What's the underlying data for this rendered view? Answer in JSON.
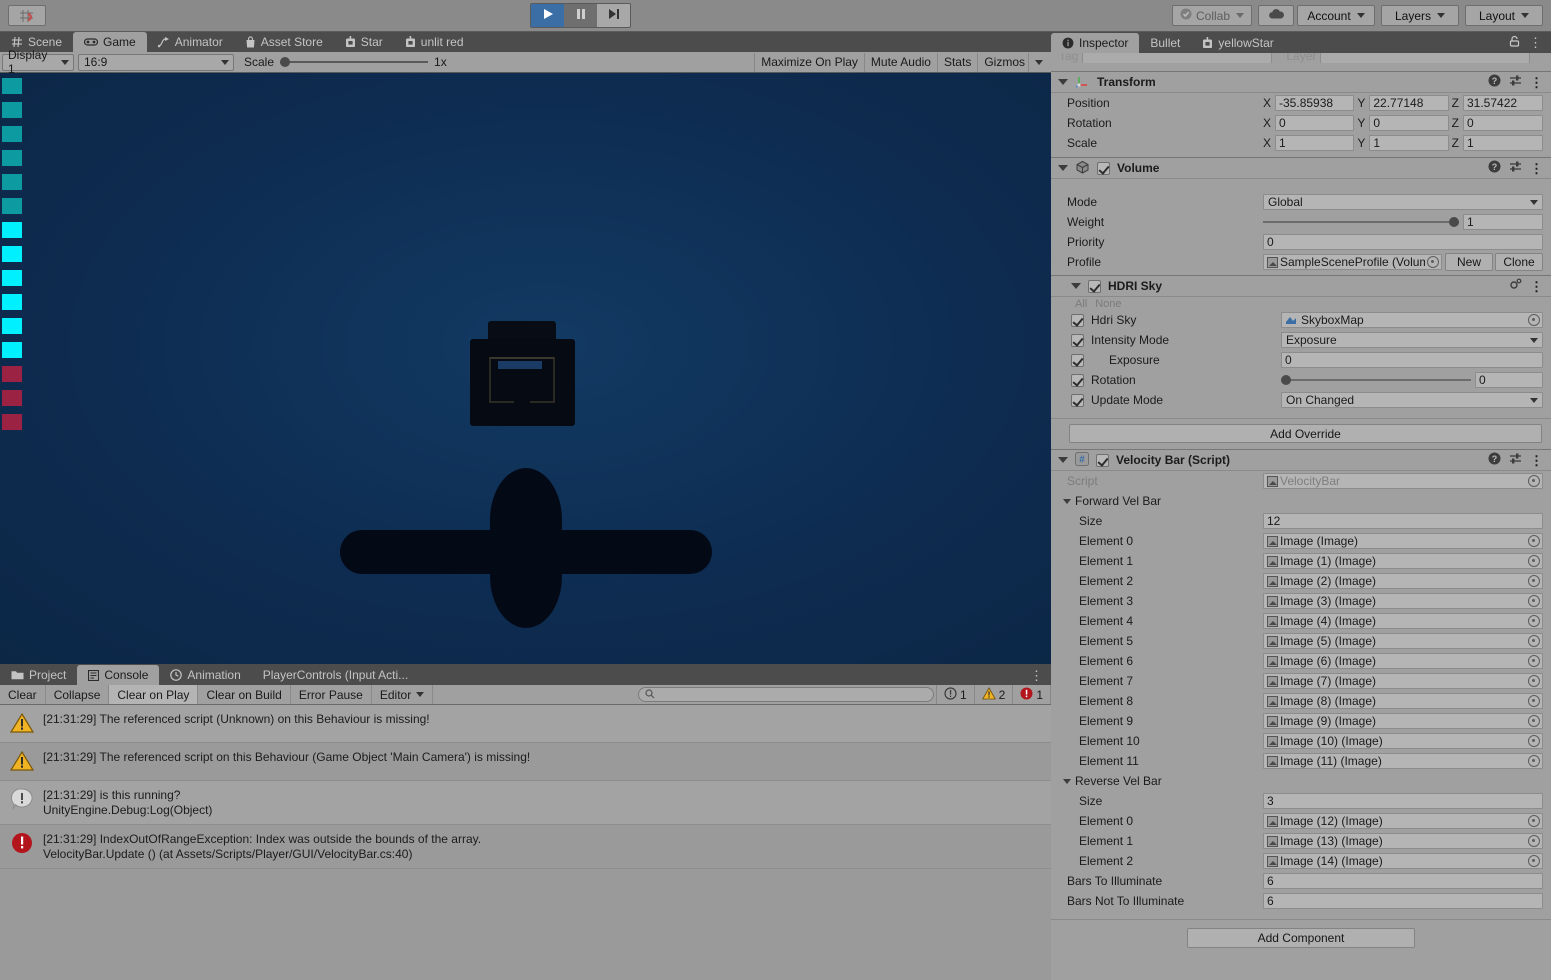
{
  "toolbar": {
    "snap_icon": "grid-snap-icon",
    "play_label": "play-icon",
    "pause_label": "pause-icon",
    "step_label": "step-icon",
    "collab": "Collab",
    "cloud": "cloud-icon",
    "account": "Account",
    "layers": "Layers",
    "layout": "Layout"
  },
  "game_panel": {
    "tabs": [
      {
        "label": "Scene",
        "icon": "hash-icon",
        "active": false
      },
      {
        "label": "Game",
        "icon": "gamepad-icon",
        "active": true
      },
      {
        "label": "Animator",
        "icon": "animator-icon",
        "active": false
      },
      {
        "label": "Asset Store",
        "icon": "store-icon",
        "active": false
      },
      {
        "label": "Star",
        "icon": "prefab-icon",
        "active": false
      },
      {
        "label": "unlit red",
        "icon": "prefab-icon",
        "active": false
      }
    ],
    "display": "Display 1",
    "aspect": "16:9",
    "scale_label": "Scale",
    "scale_value": "1x",
    "maximize_on_play": "Maximize On Play",
    "mute_audio": "Mute Audio",
    "stats": "Stats",
    "gizmos": "Gizmos"
  },
  "game_render": {
    "background_color": "#0e2c51",
    "bars": [
      {
        "color": "#0d9aa0",
        "state": "dim"
      },
      {
        "color": "#0d9aa0",
        "state": "dim"
      },
      {
        "color": "#0d9aa0",
        "state": "dim"
      },
      {
        "color": "#0d9aa0",
        "state": "dim"
      },
      {
        "color": "#0d9aa0",
        "state": "dim"
      },
      {
        "color": "#0d9aa0",
        "state": "dim"
      },
      {
        "color": "#00f0ff",
        "state": "lit"
      },
      {
        "color": "#00f0ff",
        "state": "lit"
      },
      {
        "color": "#00f0ff",
        "state": "lit"
      },
      {
        "color": "#00f0ff",
        "state": "lit"
      },
      {
        "color": "#00f0ff",
        "state": "lit"
      },
      {
        "color": "#00f0ff",
        "state": "lit"
      },
      {
        "color": "#9c2244",
        "state": "reverse"
      },
      {
        "color": "#9c2244",
        "state": "reverse"
      },
      {
        "color": "#9c2244",
        "state": "reverse"
      }
    ]
  },
  "console_panel": {
    "tabs": [
      {
        "label": "Project",
        "icon": "folder-icon",
        "active": false
      },
      {
        "label": "Console",
        "icon": "console-icon",
        "active": true
      },
      {
        "label": "Animation",
        "icon": "clock-icon",
        "active": false
      },
      {
        "label": "PlayerControls (Input Acti...",
        "icon": "",
        "active": false
      }
    ],
    "buttons": [
      {
        "label": "Clear",
        "pressed": false
      },
      {
        "label": "Collapse",
        "pressed": false
      },
      {
        "label": "Clear on Play",
        "pressed": true
      },
      {
        "label": "Clear on Build",
        "pressed": false
      },
      {
        "label": "Error Pause",
        "pressed": false
      },
      {
        "label": "Editor",
        "pressed": false,
        "dropdown": true
      }
    ],
    "search_placeholder": "",
    "counts": {
      "info": "1",
      "warning": "2",
      "error": "1"
    },
    "logs": [
      {
        "type": "warning",
        "line1": "[21:31:29] The referenced script (Unknown) on this Behaviour is missing!",
        "line2": ""
      },
      {
        "type": "warning",
        "line1": "[21:31:29] The referenced script on this Behaviour (Game Object 'Main Camera') is missing!",
        "line2": ""
      },
      {
        "type": "info",
        "line1": "[21:31:29] is this running?",
        "line2": "UnityEngine.Debug:Log(Object)"
      },
      {
        "type": "error",
        "line1": "[21:31:29] IndexOutOfRangeException: Index was outside the bounds of the array.",
        "line2": "VelocityBar.Update () (at Assets/Scripts/Player/GUI/VelocityBar.cs:40)"
      }
    ]
  },
  "inspector": {
    "tabs": [
      {
        "label": "Inspector",
        "icon": "info-icon",
        "active": true
      },
      {
        "label": "Bullet",
        "icon": "",
        "active": false
      },
      {
        "label": "yellowStar",
        "icon": "prefab-icon",
        "active": false
      }
    ],
    "lock_icon": "lock-icon",
    "kebab_icon": "kebab-icon",
    "tag_label": "Tag",
    "layer_label": "Layer",
    "transform": {
      "title": "Transform",
      "rows": [
        {
          "label": "Position",
          "x": "-35.85938",
          "y": "22.77148",
          "z": "31.57422"
        },
        {
          "label": "Rotation",
          "x": "0",
          "y": "0",
          "z": "0"
        },
        {
          "label": "Scale",
          "x": "1",
          "y": "1",
          "z": "1"
        }
      ],
      "axis_labels": [
        "X",
        "Y",
        "Z"
      ]
    },
    "volume": {
      "title": "Volume",
      "mode_label": "Mode",
      "mode_value": "Global",
      "weight_label": "Weight",
      "weight_value": "1",
      "priority_label": "Priority",
      "priority_value": "0",
      "profile_label": "Profile",
      "profile_value": "SampleSceneProfile (Volume",
      "new_button": "New",
      "clone_button": "Clone"
    },
    "hdri_sky": {
      "title": "HDRI Sky",
      "all_label": "All",
      "none_label": "None",
      "rows": [
        {
          "label": "Hdri Sky",
          "value": "SkyboxMap",
          "kind": "object"
        },
        {
          "label": "Intensity Mode",
          "value": "Exposure",
          "kind": "dropdown"
        },
        {
          "label": "Exposure",
          "value": "0",
          "kind": "text",
          "indent": true
        },
        {
          "label": "Rotation",
          "value": "0",
          "kind": "slider"
        },
        {
          "label": "Update Mode",
          "value": "On Changed",
          "kind": "dropdown"
        }
      ],
      "add_override": "Add Override"
    },
    "velocity_bar": {
      "title": "Velocity Bar (Script)",
      "script_label": "Script",
      "script_value": "VelocityBar",
      "forward_group_label": "Forward Vel Bar",
      "forward_size_label": "Size",
      "forward_size_value": "12",
      "forward_elements": [
        {
          "label": "Element 0",
          "value": "Image (Image)"
        },
        {
          "label": "Element 1",
          "value": "Image (1) (Image)"
        },
        {
          "label": "Element 2",
          "value": "Image (2) (Image)"
        },
        {
          "label": "Element 3",
          "value": "Image (3) (Image)"
        },
        {
          "label": "Element 4",
          "value": "Image (4) (Image)"
        },
        {
          "label": "Element 5",
          "value": "Image (5) (Image)"
        },
        {
          "label": "Element 6",
          "value": "Image (6) (Image)"
        },
        {
          "label": "Element 7",
          "value": "Image (7) (Image)"
        },
        {
          "label": "Element 8",
          "value": "Image (8) (Image)"
        },
        {
          "label": "Element 9",
          "value": "Image (9) (Image)"
        },
        {
          "label": "Element 10",
          "value": "Image (10) (Image)"
        },
        {
          "label": "Element 11",
          "value": "Image (11) (Image)"
        }
      ],
      "reverse_group_label": "Reverse Vel Bar",
      "reverse_size_label": "Size",
      "reverse_size_value": "3",
      "reverse_elements": [
        {
          "label": "Element 0",
          "value": "Image (12) (Image)"
        },
        {
          "label": "Element 1",
          "value": "Image (13) (Image)"
        },
        {
          "label": "Element 2",
          "value": "Image (14) (Image)"
        }
      ],
      "bars_to_illuminate_label": "Bars To Illuminate",
      "bars_to_illuminate_value": "6",
      "bars_not_to_illuminate_label": "Bars Not To Illuminate",
      "bars_not_to_illuminate_value": "6"
    },
    "add_component": "Add Component"
  }
}
